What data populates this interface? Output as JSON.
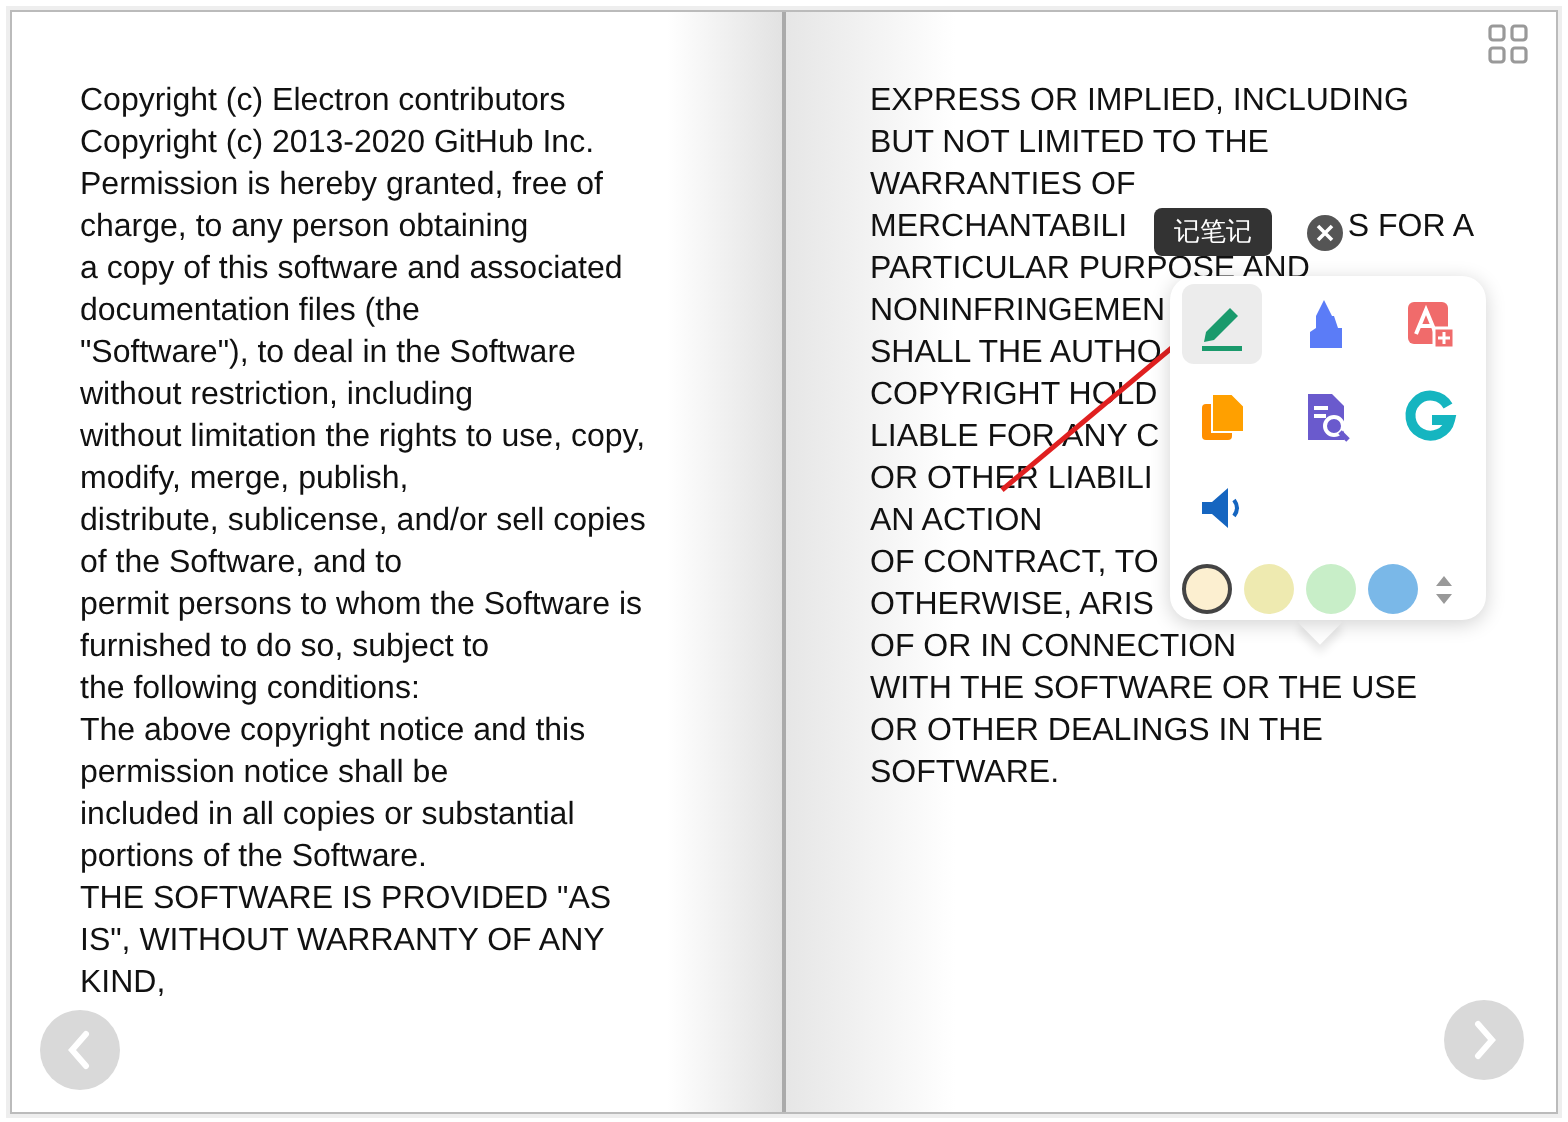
{
  "left_page": {
    "lines": [
      {
        "text": "Copyright (c) Electron contributors"
      },
      {
        "text": "Copyright (c) 2013-2020 GitHub Inc."
      },
      {
        "text": "Permission is hereby granted, free of"
      },
      {
        "text": "charge, to any person obtaining"
      },
      {
        "text": "a copy of this software and associated"
      },
      {
        "text": "documentation files (the"
      },
      {
        "text": "\"Software\"), to deal in the Software"
      },
      {
        "text": "without restriction, including"
      },
      {
        "text": "without limitation the rights to use, copy,"
      },
      {
        "text": "modify, merge, publish,"
      },
      {
        "text": "distribute, sublicense, and/or sell copies"
      },
      {
        "text": "of the Software, and to"
      },
      {
        "text": "permit persons to whom the Software is"
      },
      {
        "text": "furnished to do so, subject to"
      },
      {
        "text": "the following conditions:"
      },
      {
        "text": "The above copyright notice and this"
      },
      {
        "text": "permission notice shall be"
      },
      {
        "text": "included in all copies or substantial"
      },
      {
        "text": "portions of the Software."
      },
      {
        "text": "THE SOFTWARE IS PROVIDED \"AS"
      },
      {
        "text": "IS\", WITHOUT WARRANTY OF ANY"
      },
      {
        "text": "KIND,"
      }
    ]
  },
  "right_page": {
    "lines": [
      {
        "text": "EXPRESS OR IMPLIED, INCLUDING"
      },
      {
        "text": "BUT NOT LIMITED TO THE"
      },
      {
        "text": "WARRANTIES OF"
      },
      {
        "segments": [
          "MERCHANTABILI",
          "S FOR A"
        ]
      },
      {
        "text": "PARTICULAR PURPOSE AND"
      },
      {
        "text": "NONINFRINGEMEN"
      },
      {
        "text": "SHALL THE AUTHO"
      },
      {
        "text": "COPYRIGHT HOLD"
      },
      {
        "text": "LIABLE FOR ANY C"
      },
      {
        "text": "OR OTHER LIABILI"
      },
      {
        "text": "AN ACTION"
      },
      {
        "text": "OF CONTRACT, TO"
      },
      {
        "text": "OTHERWISE, ARIS"
      },
      {
        "text": "OF OR IN CONNECTION"
      },
      {
        "text": "WITH THE SOFTWARE OR THE USE"
      },
      {
        "text": "OR OTHER DEALINGS IN THE"
      },
      {
        "text": "SOFTWARE."
      }
    ]
  },
  "tooltip": {
    "label": "记笔记"
  },
  "toolbar": {
    "tools": [
      {
        "selected": true
      },
      {
        "selected": false
      },
      {
        "selected": false
      },
      {
        "selected": false
      },
      {
        "selected": false
      },
      {
        "selected": false
      },
      {
        "selected": false
      }
    ],
    "colors": [
      {
        "color": "#fcefd0",
        "selected": true
      },
      {
        "color": "#eeeab0",
        "selected": false
      },
      {
        "color": "#c8eec8",
        "selected": false
      },
      {
        "color": "#7ab8e8",
        "selected": false
      }
    ]
  }
}
